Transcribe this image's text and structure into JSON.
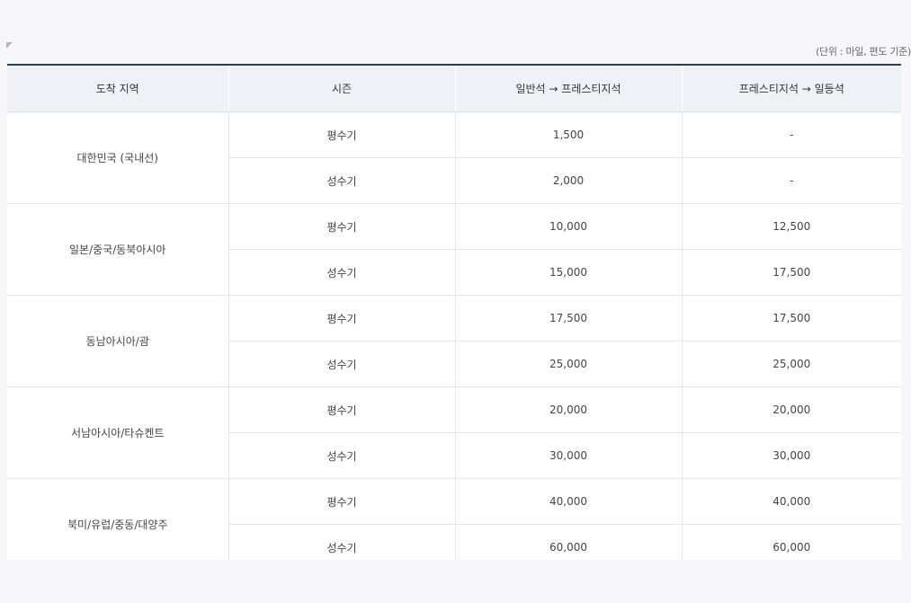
{
  "unit_note": "(단위 : 마일, 편도 기준)",
  "table": {
    "headers": [
      "도착 지역",
      "시즌",
      "일반석 → 프레스티지석",
      "프레스티지석 → 일등석"
    ],
    "groups": [
      {
        "region": "대한민국 (국내선)",
        "rows": [
          {
            "season": "평수기",
            "economy_to_prestige": "1,500",
            "prestige_to_first": "-"
          },
          {
            "season": "성수기",
            "economy_to_prestige": "2,000",
            "prestige_to_first": "-"
          }
        ]
      },
      {
        "region": "일본/중국/동북아시아",
        "rows": [
          {
            "season": "평수기",
            "economy_to_prestige": "10,000",
            "prestige_to_first": "12,500"
          },
          {
            "season": "성수기",
            "economy_to_prestige": "15,000",
            "prestige_to_first": "17,500"
          }
        ]
      },
      {
        "region": "동남아시아/괌",
        "rows": [
          {
            "season": "평수기",
            "economy_to_prestige": "17,500",
            "prestige_to_first": "17,500"
          },
          {
            "season": "성수기",
            "economy_to_prestige": "25,000",
            "prestige_to_first": "25,000"
          }
        ]
      },
      {
        "region": "서남아시아/타슈켄트",
        "rows": [
          {
            "season": "평수기",
            "economy_to_prestige": "20,000",
            "prestige_to_first": "20,000"
          },
          {
            "season": "성수기",
            "economy_to_prestige": "30,000",
            "prestige_to_first": "30,000"
          }
        ]
      },
      {
        "region": "북미/유럽/중동/대양주",
        "rows": [
          {
            "season": "평수기",
            "economy_to_prestige": "40,000",
            "prestige_to_first": "40,000"
          },
          {
            "season": "성수기",
            "economy_to_prestige": "60,000",
            "prestige_to_first": "60,000"
          }
        ]
      }
    ]
  }
}
